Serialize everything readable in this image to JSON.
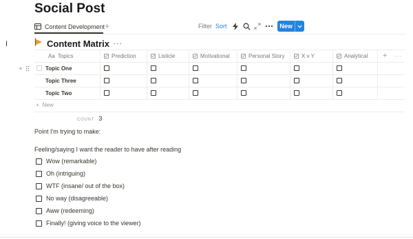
{
  "page": {
    "title": "Social Post"
  },
  "views": {
    "active_tab": "Content Development",
    "add_view": "+"
  },
  "toolbar": {
    "filter": "Filter",
    "sort": "Sort",
    "new_label": "New",
    "accent": "#2383e2"
  },
  "database": {
    "title": "Content Matrix",
    "more": "···",
    "columns": [
      {
        "prefix": "Aa",
        "label": "Topics"
      },
      {
        "label": "Prediction"
      },
      {
        "label": "Listicle"
      },
      {
        "label": "Motivational"
      },
      {
        "label": "Personal Story"
      },
      {
        "label": "X v Y"
      },
      {
        "label": "Analytical"
      }
    ],
    "add_column": "+",
    "column_menu": "···",
    "rows": [
      {
        "topic": "Topic One",
        "checks": [
          false,
          false,
          false,
          false,
          false,
          false
        ]
      },
      {
        "topic": "Topic Three",
        "checks": [
          false,
          false,
          false,
          false,
          false,
          false
        ]
      },
      {
        "topic": "Topic Two",
        "checks": [
          false,
          false,
          false,
          false,
          false,
          false
        ]
      }
    ],
    "new_row": {
      "plus": "+",
      "label": "New"
    },
    "count": {
      "label": "COUNT",
      "value": "3"
    }
  },
  "body": {
    "point_line": "Point I'm trying to make:",
    "feeling_line": "Feeling/saying I want the reader to have after reading",
    "todos": [
      "Wow (remarkable)",
      "Oh (intriguing)",
      "WTF (insane/ out of the box)",
      "No way (disagreeable)",
      "Aww (redeeming)",
      "Finally! (giving voice to the viewer)"
    ]
  }
}
